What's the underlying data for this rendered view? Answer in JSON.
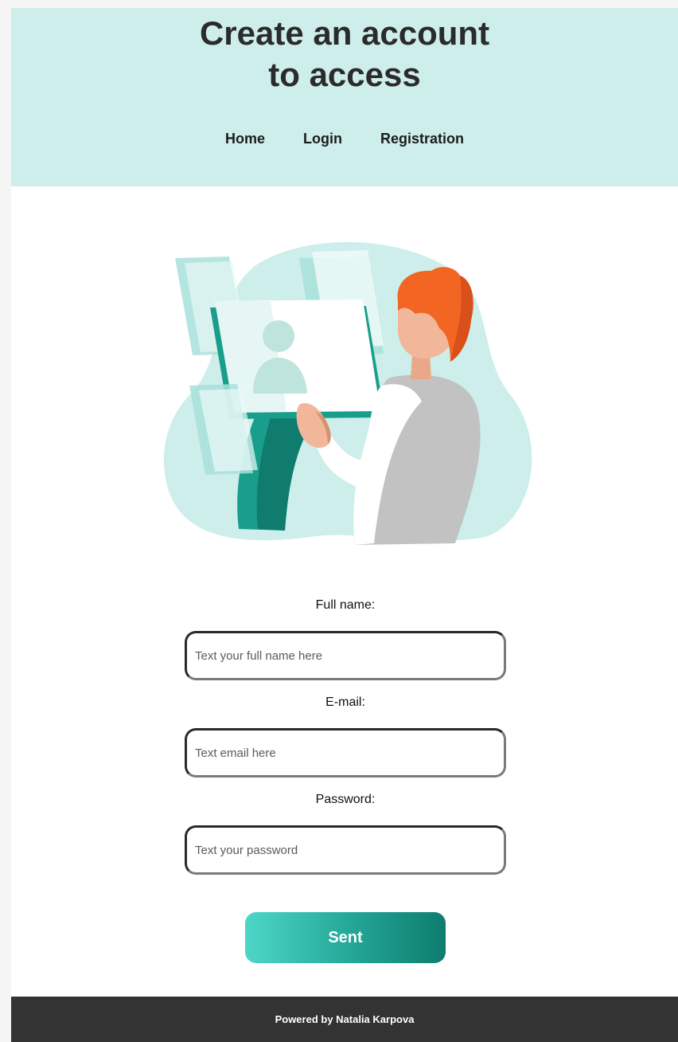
{
  "header": {
    "title": "Create an account\nto access",
    "nav": [
      {
        "label": "Home"
      },
      {
        "label": "Login"
      },
      {
        "label": "Registration"
      }
    ]
  },
  "illustration": {
    "icon": "person-at-kiosk-illustration",
    "colors": {
      "blob": "#cdeeeb",
      "teal": "#1a9e8c",
      "hair": "#f26522",
      "skin": "#f2b79a",
      "shirt": "#bdbdbd"
    }
  },
  "form": {
    "fullname": {
      "label": "Full name:",
      "placeholder": "Text your full name here"
    },
    "email": {
      "label": "E-mail:",
      "placeholder": "Text email here"
    },
    "password": {
      "label": "Password:",
      "placeholder": "Text your password"
    },
    "submit_label": "Sent"
  },
  "footer": {
    "text": "Powered by Natalia Karpova"
  },
  "colors": {
    "header_bg": "#cdeeeb",
    "footer_bg": "#333333",
    "button_gradient_start": "#4dd6c8",
    "button_gradient_end": "#0e7d6f"
  }
}
